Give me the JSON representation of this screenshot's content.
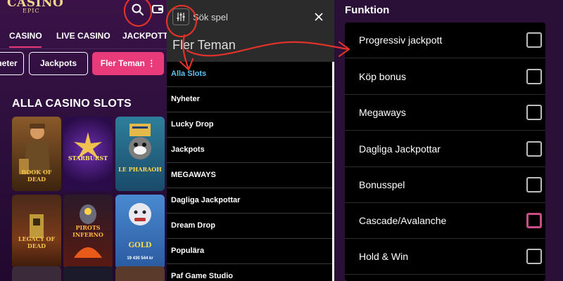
{
  "casino": {
    "logo_top": "CASINO",
    "logo_bottom": "EPIC",
    "nav": [
      "CASINO",
      "LIVE CASINO",
      "JACKPOTT"
    ],
    "chips": [
      "heter",
      "Jackpots",
      "Fler Teman"
    ],
    "chip_more_glyph": "⋮",
    "section_title": "ALLA CASINO SLOTS",
    "tiles": [
      {
        "caption": "BOOK OF DEAD"
      },
      {
        "caption": "STARBURST"
      },
      {
        "caption": "LE PHARAOH"
      },
      {
        "caption": "LEGACY OF DEAD"
      },
      {
        "caption": "PIROTS INFERNO"
      },
      {
        "caption": "GOLD"
      }
    ],
    "tile_amount": "19 430 544 kr",
    "icons": {
      "search": "search-icon",
      "wallet": "wallet-icon"
    },
    "colors": {
      "accent": "#e93b7a",
      "gold": "#f0d68a"
    }
  },
  "search_panel": {
    "placeholder": "Sök spel",
    "heading": "Fler Teman",
    "items": [
      "Alla Slots",
      "Nyheter",
      "Lucky Drop",
      "Jackpots",
      "MEGAWAYS",
      "Dagliga Jackpottar",
      "Dream Drop",
      "Populära",
      "Paf Game Studio"
    ],
    "active_color": "#5fc2f5",
    "icons": {
      "filter": "sliders-icon",
      "close": "close-icon"
    }
  },
  "filter_panel": {
    "title": "Funktion",
    "options": [
      {
        "label": "Progressiv jackpott",
        "checked": false
      },
      {
        "label": "Köp bonus",
        "checked": false
      },
      {
        "label": "Megaways",
        "checked": false
      },
      {
        "label": "Dagliga Jackpottar",
        "checked": false
      },
      {
        "label": "Bonusspel",
        "checked": false
      },
      {
        "label": "Cascade/Avalanche",
        "checked": false,
        "focused": true
      },
      {
        "label": "Hold & Win",
        "checked": false
      }
    ],
    "focus_color": "#c94d86"
  },
  "annotation_color": "#e0322a"
}
